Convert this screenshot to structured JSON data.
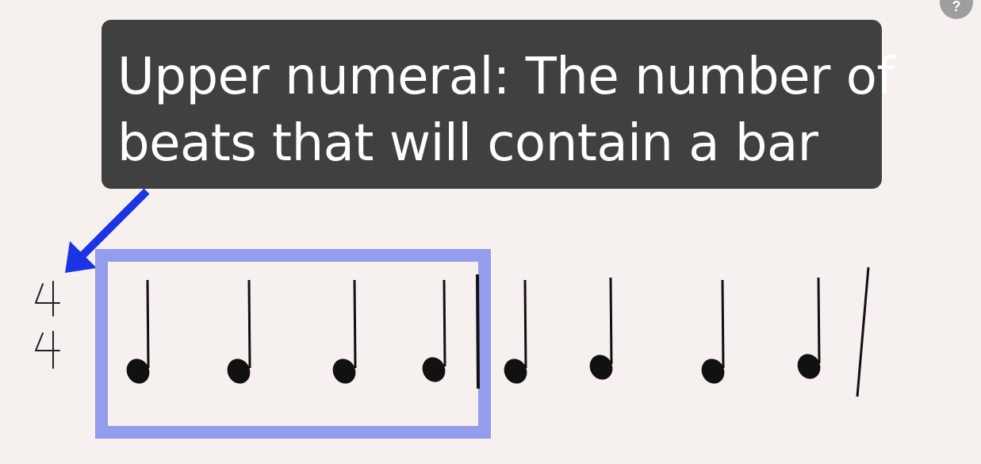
{
  "callout": {
    "line1": "Upper numeral: The number of",
    "line2": "beats that will contain a bar"
  },
  "help_button": {
    "label": "?"
  },
  "time_signature": {
    "upper": "4",
    "lower": "4"
  },
  "colors": {
    "background": "#f6f0ee",
    "callout_bg": "#404040",
    "callout_text": "#ffffff",
    "arrow": "#1b35e6",
    "highlight_box": "#949cee",
    "ink": "#111111"
  },
  "icons": {
    "arrow": "arrow-down-left-icon",
    "notes": "quarter-note-icon",
    "bar_line": "bar-line"
  }
}
